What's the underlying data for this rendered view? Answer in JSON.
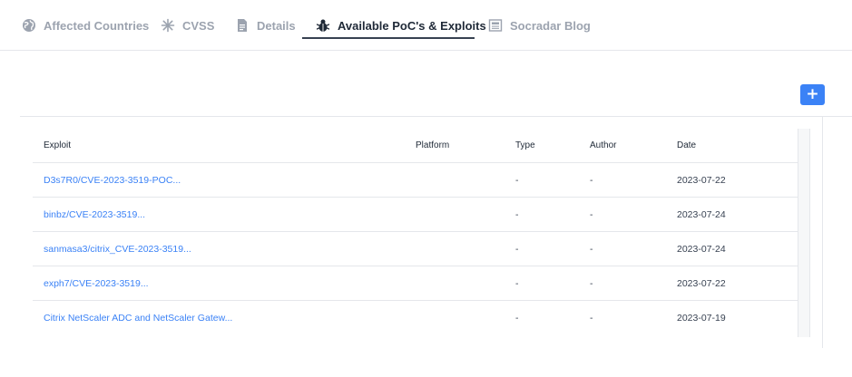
{
  "tabs": [
    {
      "label": "Affected Countries",
      "icon": "globe-icon"
    },
    {
      "label": "CVSS",
      "icon": "asterisk-icon"
    },
    {
      "label": "Details",
      "icon": "document-icon"
    },
    {
      "label": "Available PoC's & Exploits",
      "icon": "bug-icon",
      "active": true
    },
    {
      "label": "Socradar Blog",
      "icon": "newspaper-icon"
    }
  ],
  "add_button": {
    "label": "+"
  },
  "table": {
    "headers": {
      "exploit": "Exploit",
      "platform": "Platform",
      "type": "Type",
      "author": "Author",
      "date": "Date"
    },
    "rows": [
      {
        "exploit": "D3s7R0/CVE-2023-3519-POC...",
        "platform": "",
        "type": "-",
        "author": "-",
        "date": "2023-07-22"
      },
      {
        "exploit": "binbz/CVE-2023-3519...",
        "platform": "",
        "type": "-",
        "author": "-",
        "date": "2023-07-24"
      },
      {
        "exploit": "sanmasa3/citrix_CVE-2023-3519...",
        "platform": "",
        "type": "-",
        "author": "-",
        "date": "2023-07-24"
      },
      {
        "exploit": "exph7/CVE-2023-3519...",
        "platform": "",
        "type": "-",
        "author": "-",
        "date": "2023-07-22"
      },
      {
        "exploit": "Citrix NetScaler ADC and NetScaler Gatew...",
        "platform": "",
        "type": "-",
        "author": "-",
        "date": "2023-07-19"
      }
    ]
  },
  "colors": {
    "accent": "#3b82f6",
    "active_tab": "#1f2937",
    "inactive_tab": "#9ca3af"
  }
}
